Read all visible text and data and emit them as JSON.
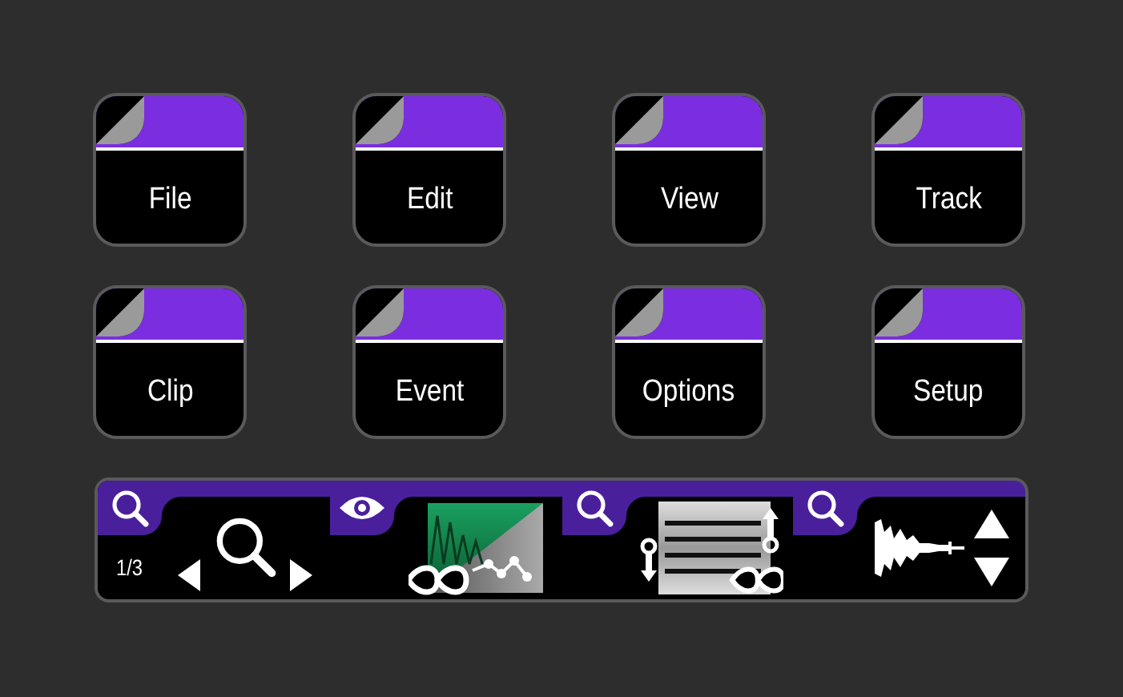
{
  "menu_buttons": [
    {
      "label": "File"
    },
    {
      "label": "Edit"
    },
    {
      "label": "View"
    },
    {
      "label": "Track"
    },
    {
      "label": "Clip"
    },
    {
      "label": "Event"
    },
    {
      "label": "Options"
    },
    {
      "label": "Setup"
    }
  ],
  "control_bar": {
    "page": "1/3",
    "sections": [
      {
        "tab": {
          "kind": "zoom"
        },
        "content": {
          "kind": "navigator"
        }
      },
      {
        "tab": {
          "kind": "view"
        },
        "content": {
          "kind": "envelope"
        }
      },
      {
        "tab": {
          "kind": "zoom"
        },
        "content": {
          "kind": "track-list"
        }
      },
      {
        "tab": {
          "kind": "zoom"
        },
        "content": {
          "kind": "waveform"
        }
      }
    ]
  }
}
